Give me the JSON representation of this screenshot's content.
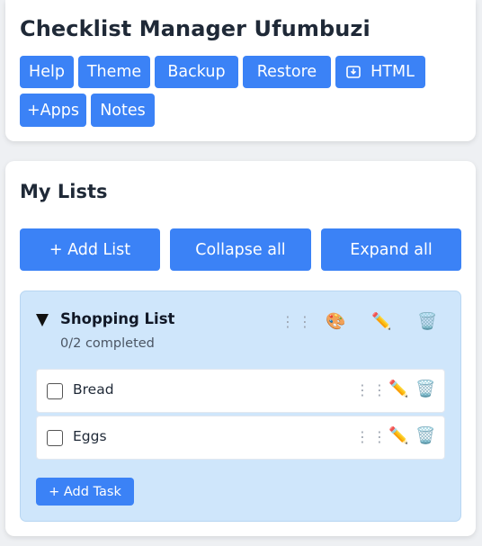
{
  "app": {
    "title": "Checklist Manager Ufumbuzi"
  },
  "toolbar": {
    "help_label": "Help",
    "theme_label": "Theme",
    "backup_label": "Backup",
    "restore_label": "Restore",
    "html_label": "HTML",
    "apps_label": "+Apps",
    "notes_label": "Notes"
  },
  "lists_section": {
    "title": "My Lists",
    "add_list_label": "+ Add List",
    "collapse_all_label": "Collapse all",
    "expand_all_label": "Expand all"
  },
  "lists": [
    {
      "name": "Shopping List",
      "progress": "0/2 completed",
      "color": "#cfe6fb",
      "icons": [
        "drag-handle",
        "palette-icon",
        "pencil-icon",
        "trash-icon"
      ],
      "tasks": [
        {
          "label": "Bread",
          "checked": false,
          "icons": [
            "drag-handle",
            "pencil-icon",
            "trash-icon"
          ]
        },
        {
          "label": "Eggs",
          "checked": false,
          "icons": [
            "drag-handle",
            "pencil-icon",
            "trash-icon"
          ]
        }
      ],
      "add_task_label": "+ Add Task"
    }
  ],
  "colors": {
    "accent": "#3b82f6",
    "background": "#eef0f3",
    "card": "#ffffff",
    "list_panel": "#cfe6fb"
  }
}
